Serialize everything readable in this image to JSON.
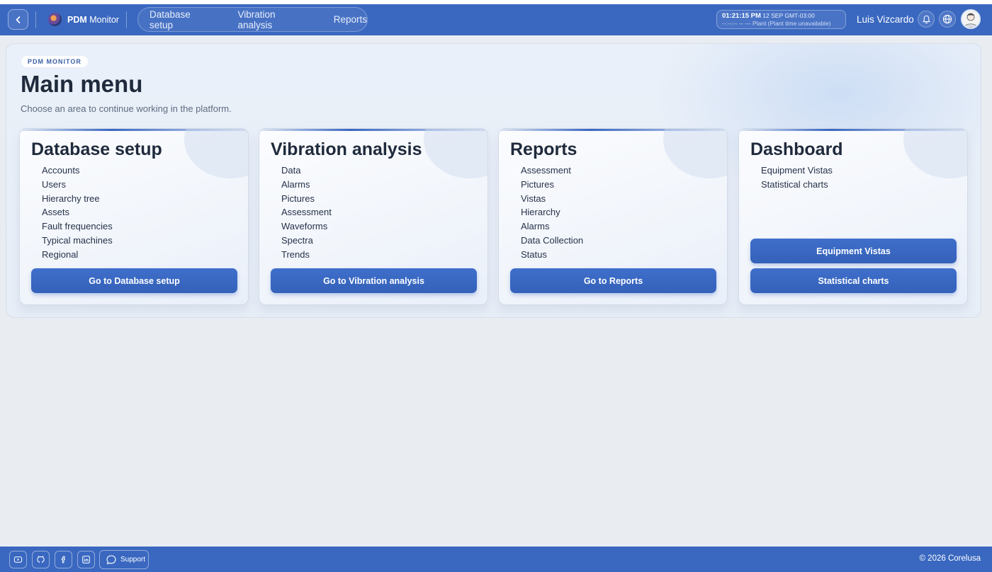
{
  "topbar": {
    "brand_bold": "PDM",
    "brand_rest": "Monitor",
    "nav": [
      "Database setup",
      "Vibration analysis",
      "Reports"
    ],
    "clock_time": "01:21:15 PM",
    "clock_date": "12 SEP",
    "clock_tz": "GMT-03:00",
    "clock_plant": "--:--:-- -- --- Plant (Plant time unavailable)",
    "user_name": "Luis Vizcardo"
  },
  "main": {
    "badge": "PDM MONITOR",
    "title": "Main menu",
    "subtitle": "Choose an area to continue working in the platform."
  },
  "cards": [
    {
      "title": "Database setup",
      "items": [
        "Accounts",
        "Users",
        "Hierarchy tree",
        "Assets",
        "Fault frequencies",
        "Typical machines",
        "Regional"
      ],
      "buttons": [
        "Go to Database setup"
      ]
    },
    {
      "title": "Vibration analysis",
      "items": [
        "Data",
        "Alarms",
        "Pictures",
        "Assessment",
        "Waveforms",
        "Spectra",
        "Trends"
      ],
      "buttons": [
        "Go to Vibration analysis"
      ]
    },
    {
      "title": "Reports",
      "items": [
        "Assessment",
        "Pictures",
        "Vistas",
        "Hierarchy",
        "Alarms",
        "Data Collection",
        "Status"
      ],
      "buttons": [
        "Go to Reports"
      ]
    },
    {
      "title": "Dashboard",
      "items": [
        "Equipment Vistas",
        "Statistical charts"
      ],
      "buttons": [
        "Equipment Vistas",
        "Statistical charts"
      ]
    }
  ],
  "footer": {
    "support_label": "Support",
    "copyright": "© 2026 Corelusa",
    "social_icons": [
      "youtube-icon",
      "github-icon",
      "facebook-icon",
      "linkedin-icon"
    ]
  },
  "colors": {
    "primary": "#3a68c0",
    "background": "#e9edf2",
    "title_text": "#1f2a3c"
  }
}
